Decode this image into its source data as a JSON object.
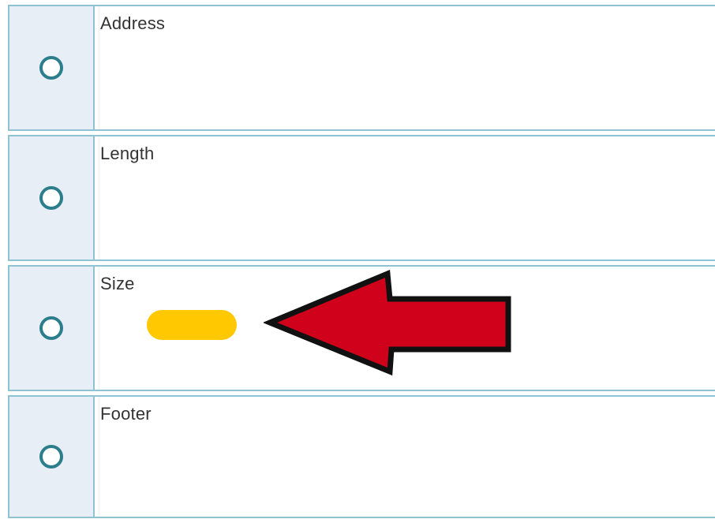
{
  "question": {
    "options": [
      {
        "label": "Address",
        "selected": false
      },
      {
        "label": "Length",
        "selected": false
      },
      {
        "label": "Size",
        "selected": false
      },
      {
        "label": "Footer",
        "selected": false
      }
    ]
  },
  "annotations": {
    "arrow_icon": "left-arrow-icon",
    "arrow_color": "#d0021b",
    "highlight_color": "#ffc800"
  }
}
